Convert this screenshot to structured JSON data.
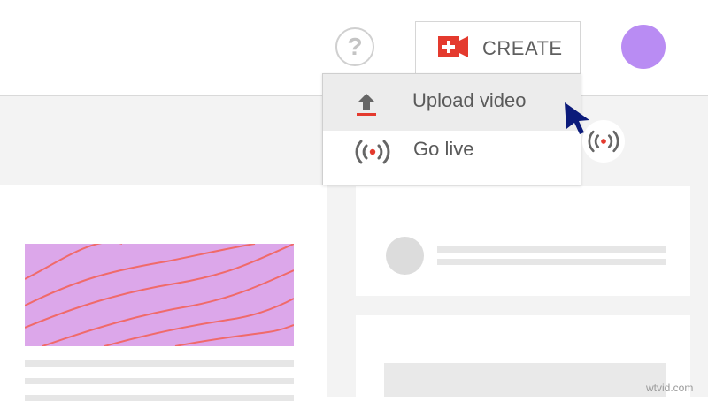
{
  "header": {
    "help_icon": "question-circle-icon",
    "help_glyph": "?",
    "create_label": "CREATE",
    "create_icon": "video-camera-plus-icon",
    "avatar_color": "#b98cf3"
  },
  "menu": {
    "items": [
      {
        "label": "Upload video",
        "icon": "upload-icon"
      },
      {
        "label": "Go live",
        "icon": "live-broadcast-icon"
      }
    ]
  },
  "colors": {
    "accent_red": "#e43a2e",
    "thumbnail_purple": "#dca7ea",
    "thumbnail_wave": "#f06a6a",
    "cursor_navy": "#0b1a7a"
  },
  "watermark": "wtvid.com"
}
